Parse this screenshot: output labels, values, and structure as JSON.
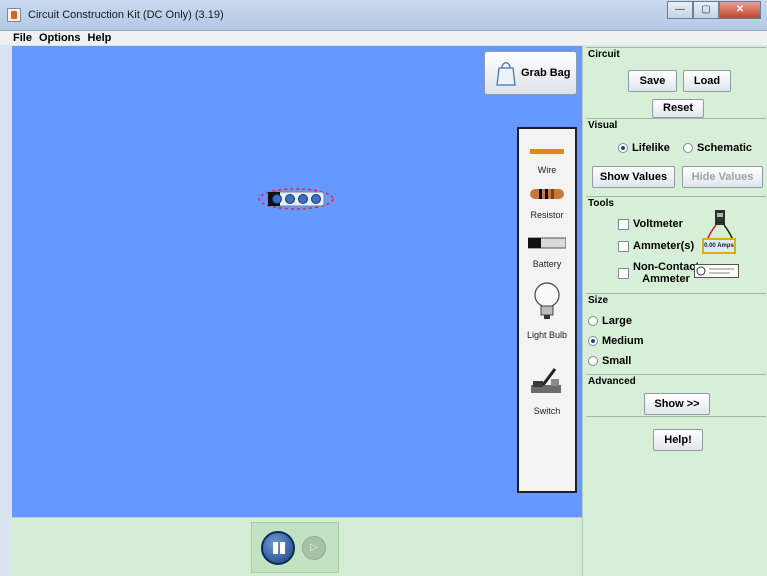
{
  "window": {
    "title": "Circuit Construction Kit (DC Only) (3.19)"
  },
  "menu": {
    "items": [
      {
        "label": "File"
      },
      {
        "label": "Options"
      },
      {
        "label": "Help"
      }
    ]
  },
  "grab_bag": {
    "label": "Grab Bag"
  },
  "toolbox": {
    "items": [
      {
        "label": "Wire",
        "icon": "wire-icon"
      },
      {
        "label": "Resistor",
        "icon": "resistor-icon"
      },
      {
        "label": "Battery",
        "icon": "battery-icon"
      },
      {
        "label": "Light Bulb",
        "icon": "light-bulb-icon"
      },
      {
        "label": "Switch",
        "icon": "switch-icon"
      }
    ]
  },
  "panel": {
    "circuit": {
      "title": "Circuit",
      "save_label": "Save",
      "load_label": "Load",
      "reset_label": "Reset"
    },
    "visual": {
      "title": "Visual",
      "options": [
        {
          "label": "Lifelike",
          "selected": true
        },
        {
          "label": "Schematic",
          "selected": false
        }
      ],
      "show_values_label": "Show Values",
      "hide_values_label": "Hide Values"
    },
    "tools": {
      "title": "Tools",
      "voltmeter_label": "Voltmeter",
      "ammeter_label": "Ammeter(s)",
      "noncontact_line1": "Non-Contact",
      "noncontact_line2": "Ammeter",
      "ammeter_reading": "0.00 Amps"
    },
    "size": {
      "title": "Size",
      "options": [
        {
          "label": "Large",
          "selected": false
        },
        {
          "label": "Medium",
          "selected": true
        },
        {
          "label": "Small",
          "selected": false
        }
      ]
    },
    "advanced": {
      "title": "Advanced",
      "show_label": "Show >>"
    },
    "help_label": "Help!"
  },
  "colors": {
    "play_area": "#6599ff",
    "panel": "#d7efd7",
    "wire": "#d98c1a"
  }
}
